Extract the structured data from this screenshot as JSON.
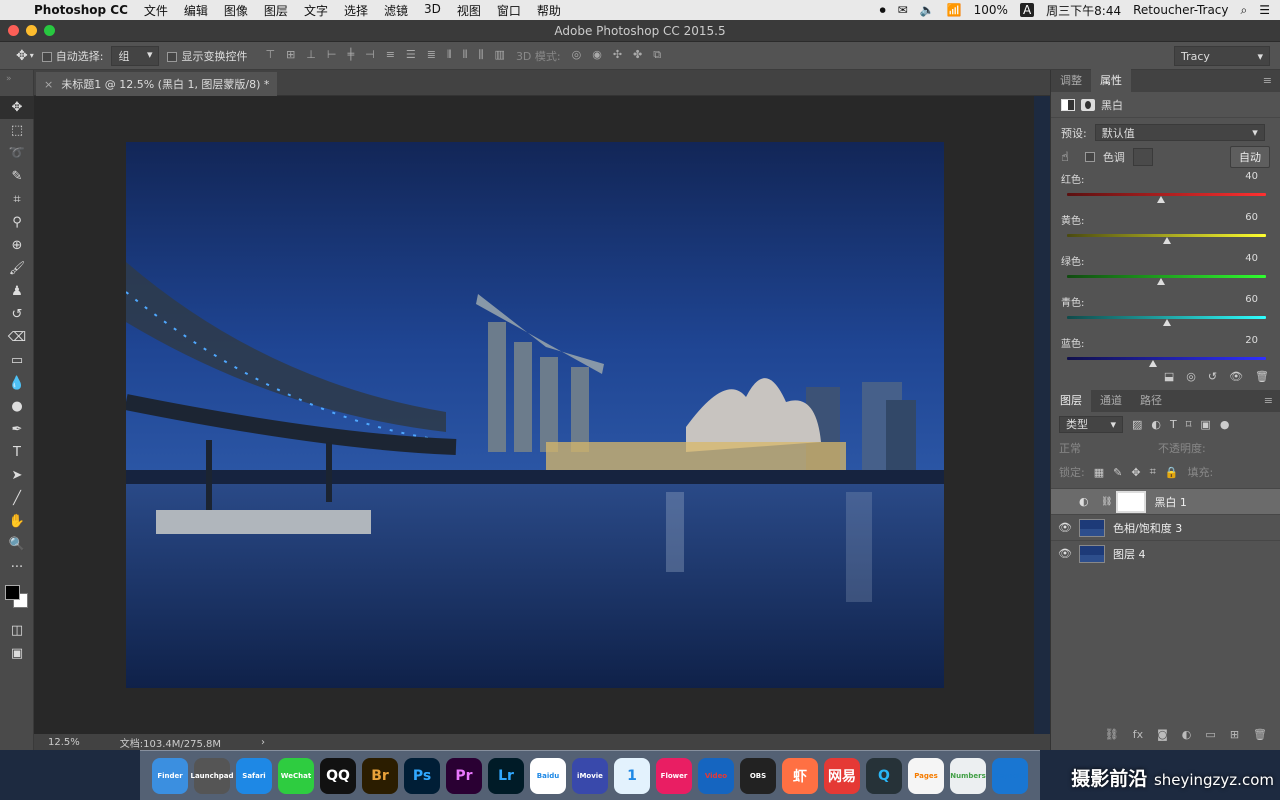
{
  "menubar": {
    "app_name": "Photoshop CC",
    "items": [
      "文件",
      "编辑",
      "图像",
      "图层",
      "文字",
      "选择",
      "滤镜",
      "3D",
      "视图",
      "窗口",
      "帮助"
    ],
    "battery": "100%",
    "clock": "周三下午8:44",
    "user": "Retoucher-Tracy",
    "input_method": "A"
  },
  "window": {
    "title": "Adobe Photoshop CC 2015.5"
  },
  "options": {
    "auto_select_label": "自动选择:",
    "auto_select_value": "组",
    "show_transform_label": "显示变换控件",
    "mode_3d": "3D 模式:",
    "workspace": "Tracy"
  },
  "document": {
    "tab_title": "未标题1 @ 12.5% (黑白 1, 图层蒙版/8) *",
    "zoom": "12.5%",
    "doc_size": "文档:103.4M/275.8M"
  },
  "properties": {
    "tab_adjust": "调整",
    "tab_props": "属性",
    "adjustment_name": "黑白",
    "preset_label": "预设:",
    "preset_value": "默认值",
    "tint_label": "色调",
    "auto_button": "自动",
    "sliders": [
      {
        "name": "红色:",
        "value": "40",
        "pos": 0.47,
        "gradient": "linear-gradient(90deg,#5a1010,#ff3030)"
      },
      {
        "name": "黄色:",
        "value": "60",
        "pos": 0.5,
        "gradient": "linear-gradient(90deg,#4a4a10,#ffff30)"
      },
      {
        "name": "绿色:",
        "value": "40",
        "pos": 0.47,
        "gradient": "linear-gradient(90deg,#104a10,#30ff30)"
      },
      {
        "name": "青色:",
        "value": "60",
        "pos": 0.5,
        "gradient": "linear-gradient(90deg,#104a4a,#30ffff)"
      },
      {
        "name": "蓝色:",
        "value": "20",
        "pos": 0.43,
        "gradient": "linear-gradient(90deg,#10104a,#3030ff)"
      }
    ]
  },
  "layers_panel": {
    "tabs": [
      "图层",
      "通道",
      "路径"
    ],
    "filter_value": "类型",
    "blend_mode": "正常",
    "opacity_label": "不透明度:",
    "lock_label": "锁定:",
    "fill_label": "填充:",
    "layers": [
      {
        "name": "黑白 1",
        "selected": true,
        "visible": false
      },
      {
        "name": "色相/饱和度 3",
        "selected": false,
        "visible": true
      },
      {
        "name": "图层 4",
        "selected": false,
        "visible": true
      }
    ]
  },
  "dock": {
    "apps": [
      "Finder",
      "Launchpad",
      "Safari",
      "WeChat",
      "QQ",
      "Br",
      "Ps",
      "Pr",
      "Lr",
      "Baidu",
      "iMovie",
      "1",
      "Flower",
      "Video",
      "OBS",
      "虾",
      "网易",
      "Q",
      "Pages",
      "Numbers",
      "Keynote"
    ]
  },
  "watermark": {
    "cn": "摄影前沿",
    "url": "sheyingzyz.com"
  }
}
